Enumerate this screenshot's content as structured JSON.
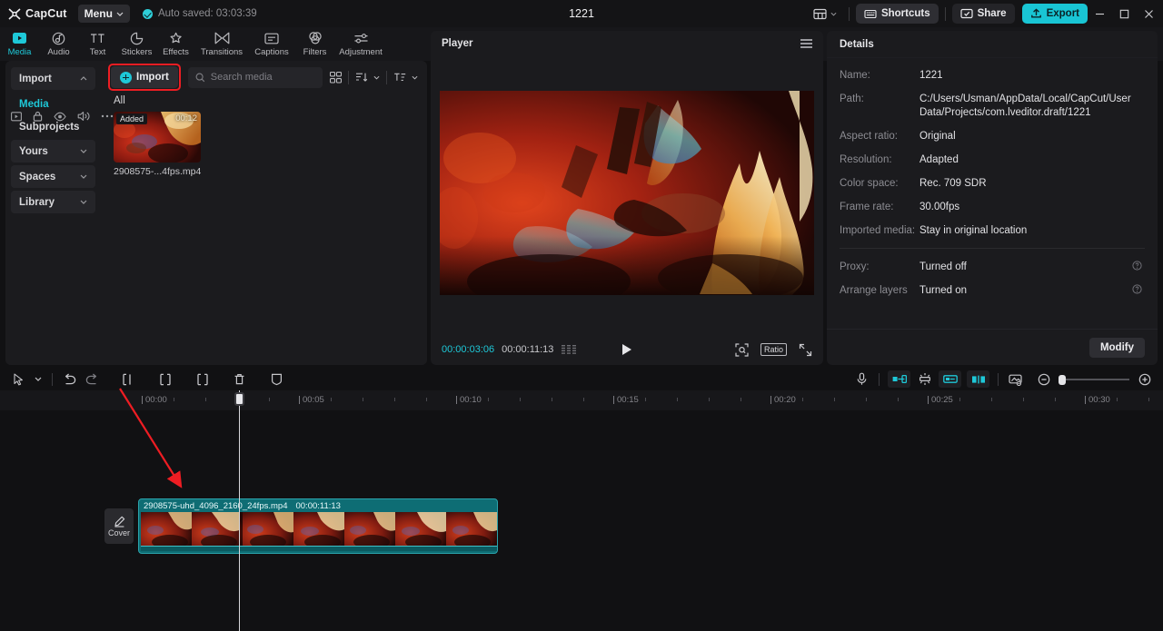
{
  "titlebar": {
    "app_name": "CapCut",
    "menu_label": "Menu",
    "autosave_text": "Auto saved: 03:03:39",
    "project_title": "1221",
    "shortcuts_label": "Shortcuts",
    "share_label": "Share",
    "export_label": "Export",
    "layout_icon": "layout-icon",
    "minimize_icon": "minimize-icon",
    "maximize_icon": "maximize-icon",
    "close_icon": "close-icon",
    "accent_color": "#19c5d4"
  },
  "modebar": {
    "items": [
      {
        "label": "Media",
        "icon": "media-icon",
        "active": true
      },
      {
        "label": "Audio",
        "icon": "audio-icon",
        "active": false
      },
      {
        "label": "Text",
        "icon": "text-icon",
        "active": false
      },
      {
        "label": "Stickers",
        "icon": "stickers-icon",
        "active": false
      },
      {
        "label": "Effects",
        "icon": "effects-icon",
        "active": false
      },
      {
        "label": "Transitions",
        "icon": "transitions-icon",
        "active": false
      },
      {
        "label": "Captions",
        "icon": "captions-icon",
        "active": false
      },
      {
        "label": "Filters",
        "icon": "filters-icon",
        "active": false
      },
      {
        "label": "Adjustment",
        "icon": "adjustment-icon",
        "active": false
      }
    ]
  },
  "media_panel": {
    "rail": [
      {
        "label": "Import",
        "type": "group",
        "expanded": true
      },
      {
        "label": "Media",
        "type": "sub",
        "active": true
      },
      {
        "label": "Subprojects",
        "type": "sub",
        "active": false
      },
      {
        "label": "Yours",
        "type": "group",
        "expanded": false
      },
      {
        "label": "Spaces",
        "type": "group",
        "expanded": false
      },
      {
        "label": "Library",
        "type": "group",
        "expanded": false
      }
    ],
    "import_button": "Import",
    "search_placeholder": "Search media",
    "filter_label": "All",
    "view_icons": [
      "grid-view-icon",
      "sort-icon",
      "filter-sort-icon"
    ],
    "items": [
      {
        "name": "2908575-...4fps.mp4",
        "badge": "Added",
        "duration": "00:12"
      }
    ]
  },
  "player": {
    "title": "Player",
    "menu_icon": "hamburger-icon",
    "current_time": "00:00:03:06",
    "total_time": "00:00:11:13",
    "play_icon": "play-icon",
    "zoom_icon": "zoom-fit-icon",
    "ratio_label": "Ratio",
    "fullscreen_icon": "fullscreen-icon"
  },
  "details": {
    "title": "Details",
    "rows": [
      {
        "key": "Name:",
        "value": "1221",
        "hint": false
      },
      {
        "key": "Path:",
        "value": "C:/Users/Usman/AppData/Local/CapCut/User Data/Projects/com.lveditor.draft/1221",
        "hint": false
      },
      {
        "key": "Aspect ratio:",
        "value": "Original",
        "hint": false
      },
      {
        "key": "Resolution:",
        "value": "Adapted",
        "hint": false
      },
      {
        "key": "Color space:",
        "value": "Rec. 709 SDR",
        "hint": false
      },
      {
        "key": "Frame rate:",
        "value": "30.00fps",
        "hint": false
      },
      {
        "key": "Imported media:",
        "value": "Stay in original location",
        "hint": false
      }
    ],
    "rows2": [
      {
        "key": "Proxy:",
        "value": "Turned off",
        "hint": true
      },
      {
        "key": "Arrange layers",
        "value": "Turned on",
        "hint": true
      }
    ],
    "modify_label": "Modify"
  },
  "timeline": {
    "toolbar_left": [
      "select-tool-icon",
      "chevron-down-icon",
      "undo-icon",
      "redo-icon",
      "split-icon",
      "trim-left-icon",
      "trim-right-icon",
      "delete-icon",
      "mask-icon"
    ],
    "toolbar_right": [
      "microphone-icon",
      "auto-cut-icon",
      "auto-captions-icon",
      "freeze-icon",
      "mirror-icon",
      "snapshot-icon",
      "zoom-out-icon",
      "zoom-slider",
      "zoom-in-icon"
    ],
    "ruler_labels": [
      "00:00",
      "00:05",
      "00:10",
      "00:15",
      "00:20",
      "00:25",
      "00:30"
    ],
    "track_header_icons": [
      "video-track-icon",
      "lock-icon",
      "eye-icon",
      "speaker-icon",
      "more-icon"
    ],
    "cover_label": "Cover",
    "cover_icon": "pencil-icon",
    "clip": {
      "name": "2908575-uhd_4096_2160_24fps.mp4",
      "duration": "00:00:11:13",
      "color": "#0e6d74"
    },
    "playhead_time": "00:00:03:06"
  }
}
